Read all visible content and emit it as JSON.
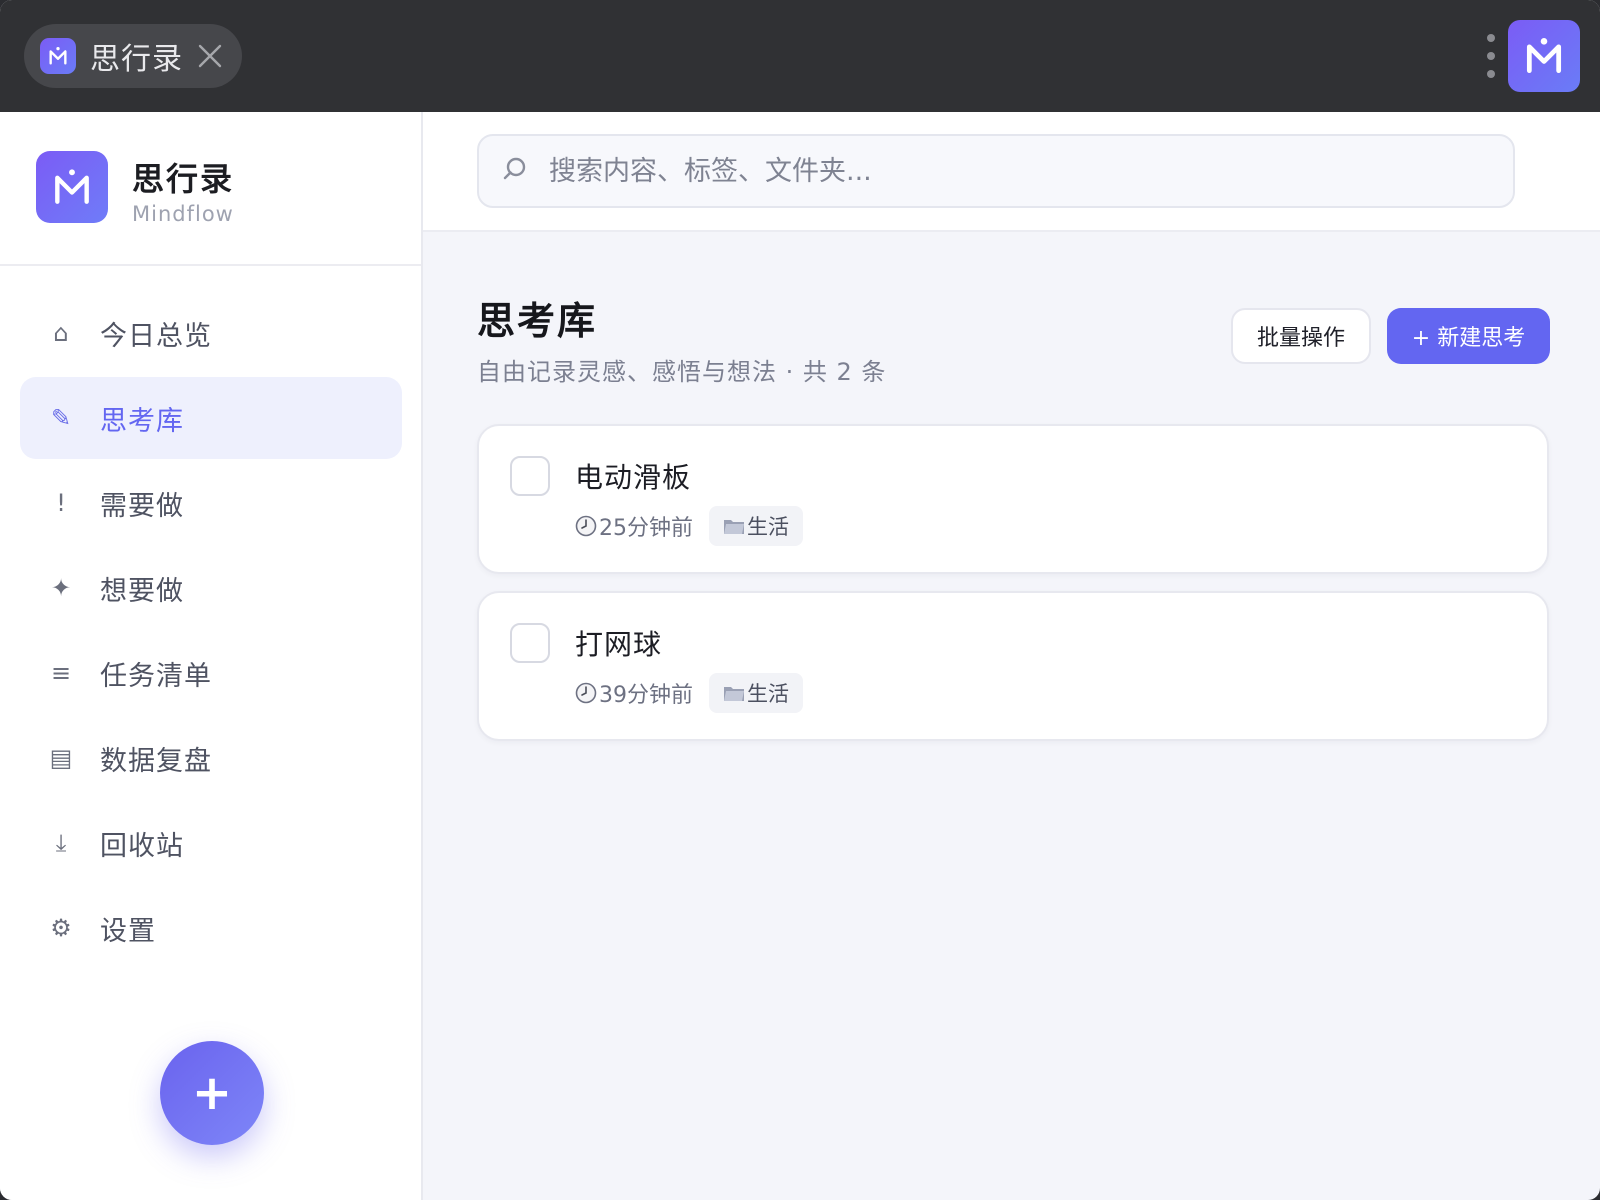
{
  "titlebar": {
    "tab_title": "思行录"
  },
  "brand": {
    "name": "思行录",
    "subtitle": "Mindflow"
  },
  "sidebar": {
    "items": [
      {
        "label": "今日总览",
        "icon": "home-icon",
        "glyph": "⌂",
        "active": false
      },
      {
        "label": "思考库",
        "icon": "pencil-icon",
        "glyph": "✎",
        "active": true
      },
      {
        "label": "需要做",
        "icon": "exclamation-icon",
        "glyph": "!",
        "active": false
      },
      {
        "label": "想要做",
        "icon": "sparkle-icon",
        "glyph": "✦",
        "active": false
      },
      {
        "label": "任务清单",
        "icon": "list-icon",
        "glyph": "≡",
        "active": false
      },
      {
        "label": "数据复盘",
        "icon": "chart-icon",
        "glyph": "▤",
        "active": false
      },
      {
        "label": "回收站",
        "icon": "download-icon",
        "glyph": "⤓",
        "active": false
      },
      {
        "label": "设置",
        "icon": "gear-icon",
        "glyph": "⚙",
        "active": false
      }
    ],
    "fab_label": "+"
  },
  "search": {
    "placeholder": "搜索内容、标签、文件夹..."
  },
  "main": {
    "title": "思考库",
    "subtitle": "自由记录灵感、感悟与想法 · 共 2 条",
    "batch_label": "批量操作",
    "new_label": "+ 新建思考"
  },
  "cards": [
    {
      "title": "电动滑板",
      "time": "25分钟前",
      "tag": "生活"
    },
    {
      "title": "打网球",
      "time": "39分钟前",
      "tag": "生活"
    }
  ],
  "colors": {
    "accent": "#6366f1",
    "titlebar": "#303134",
    "active_bg": "#eef0fd"
  }
}
